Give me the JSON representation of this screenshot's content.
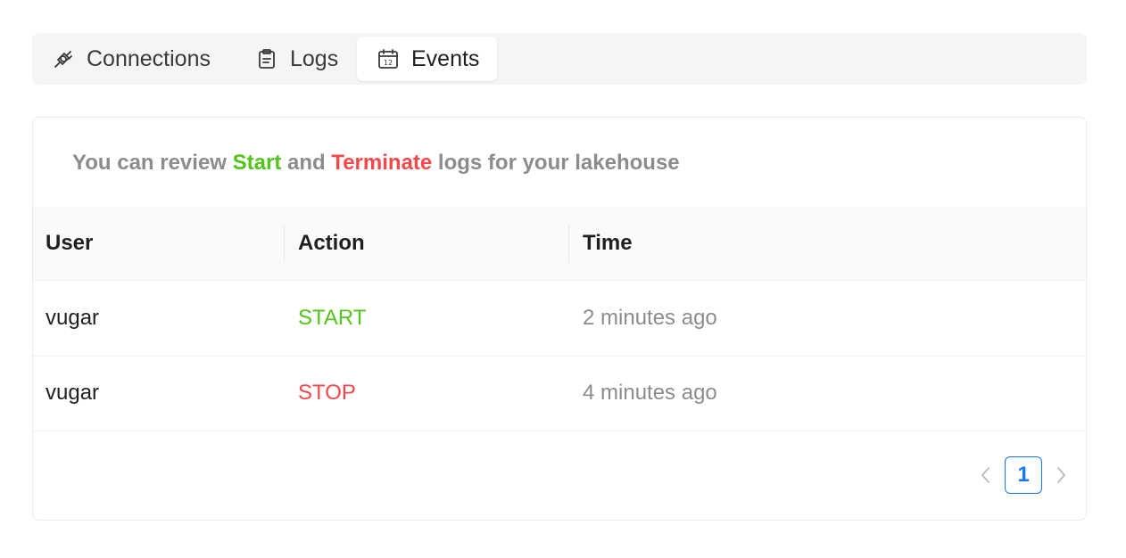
{
  "tabs": [
    {
      "label": "Connections",
      "icon": "plug-icon",
      "active": false
    },
    {
      "label": "Logs",
      "icon": "clipboard-icon",
      "active": false
    },
    {
      "label": "Events",
      "icon": "calendar-icon",
      "active": true
    }
  ],
  "intro": {
    "prefix": "You can review ",
    "start": "Start",
    "middle": " and ",
    "terminate": "Terminate",
    "suffix": " logs for your lakehouse"
  },
  "table": {
    "columns": [
      "User",
      "Action",
      "Time"
    ],
    "rows": [
      {
        "user": "vugar",
        "action": "START",
        "time": "2 minutes ago"
      },
      {
        "user": "vugar",
        "action": "STOP",
        "time": "4 minutes ago"
      }
    ]
  },
  "pagination": {
    "current_page": "1"
  },
  "colors": {
    "start": "#52c41a",
    "stop": "#f5484a",
    "accent": "#1677ff",
    "muted": "#8c8c8c"
  }
}
